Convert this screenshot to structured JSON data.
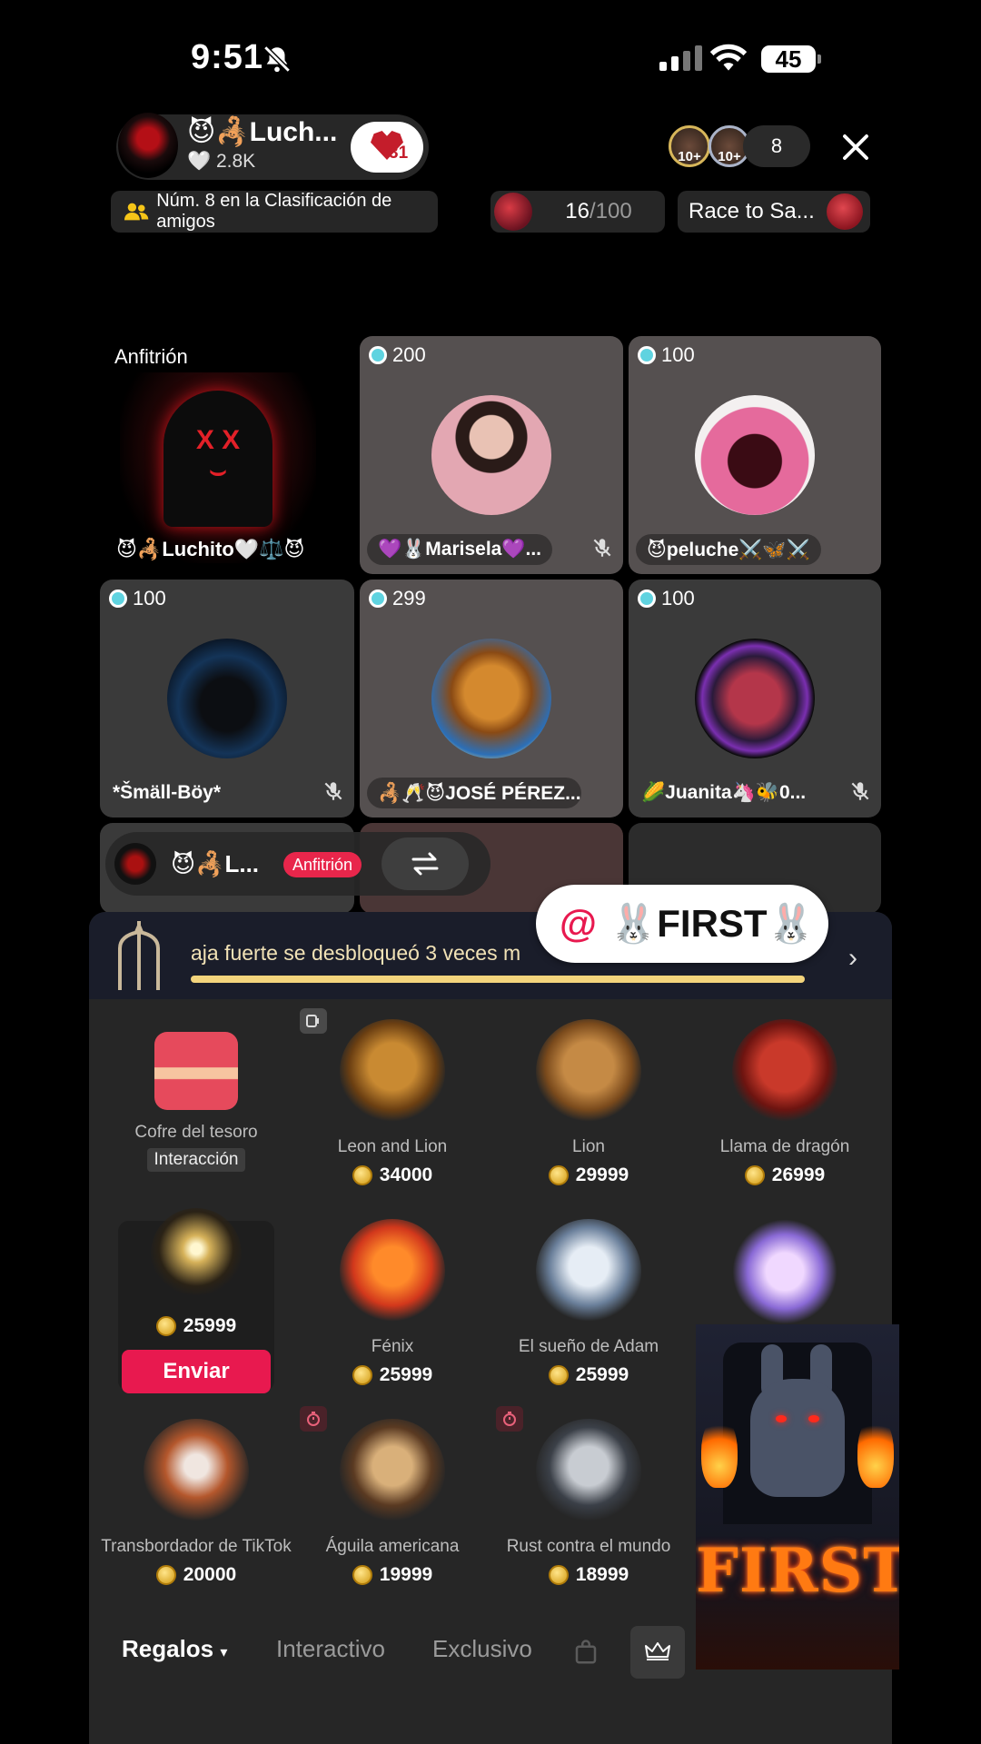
{
  "status_bar": {
    "time": "9:51",
    "battery": "45"
  },
  "host": {
    "name": "😈🦂Luch...",
    "likes": "🤍 2.8K",
    "badge_level": "31",
    "viewer_badge_1": "10+",
    "viewer_badge_2": "10+",
    "viewer_count": "8"
  },
  "chips": {
    "rank": "Núm. 8 en la Clasificación de amigos",
    "goal_current": "16",
    "goal_total": "/100",
    "race": "Race to Sa..."
  },
  "grid": {
    "host_label": "Anfitrión",
    "host_name": "😈🦂Luchito🤍⚖️😈",
    "guests": [
      {
        "score": "200",
        "name": "💜🐰Marisela💜..."
      },
      {
        "score": "100",
        "name": "😈peluche⚔️🦋⚔️"
      },
      {
        "score": "100",
        "name": "*Šmäll-Böy*"
      },
      {
        "score": "299",
        "name": "🦂🥂😈JOSÉ PÉREZ..."
      },
      {
        "score": "100",
        "name": "🌽Juanita🦄🐝0..."
      }
    ]
  },
  "cohost": {
    "name": "😈🦂L...",
    "tag": "Anfitrión"
  },
  "banner": {
    "text": "aja fuerte se desbloqueó 3 veces m"
  },
  "mention": {
    "at": "@",
    "text": "🐰FIRST🐰"
  },
  "gifts": {
    "row1": [
      {
        "name": "Cofre del tesoro",
        "tag": "Interacción"
      },
      {
        "name": "Leon and Lion",
        "price": "34000"
      },
      {
        "name": "Lion",
        "price": "29999"
      },
      {
        "name": "Llama de dragón",
        "price": "26999"
      }
    ],
    "row2": [
      {
        "price": "25999",
        "action": "Enviar"
      },
      {
        "name": "Fénix",
        "price": "25999"
      },
      {
        "name": "El sueño de Adam",
        "price": "25999"
      }
    ],
    "row3": [
      {
        "name": "Transbordador de TikTok",
        "price": "20000"
      },
      {
        "name": "Águila americana",
        "price": "19999"
      },
      {
        "name": "Rust contra el mundo",
        "price": "18999"
      }
    ]
  },
  "overlay_text": "FIRST",
  "tabs": {
    "gifts": "Regalos",
    "interactive": "Interactivo",
    "exclusive": "Exclusivo"
  }
}
